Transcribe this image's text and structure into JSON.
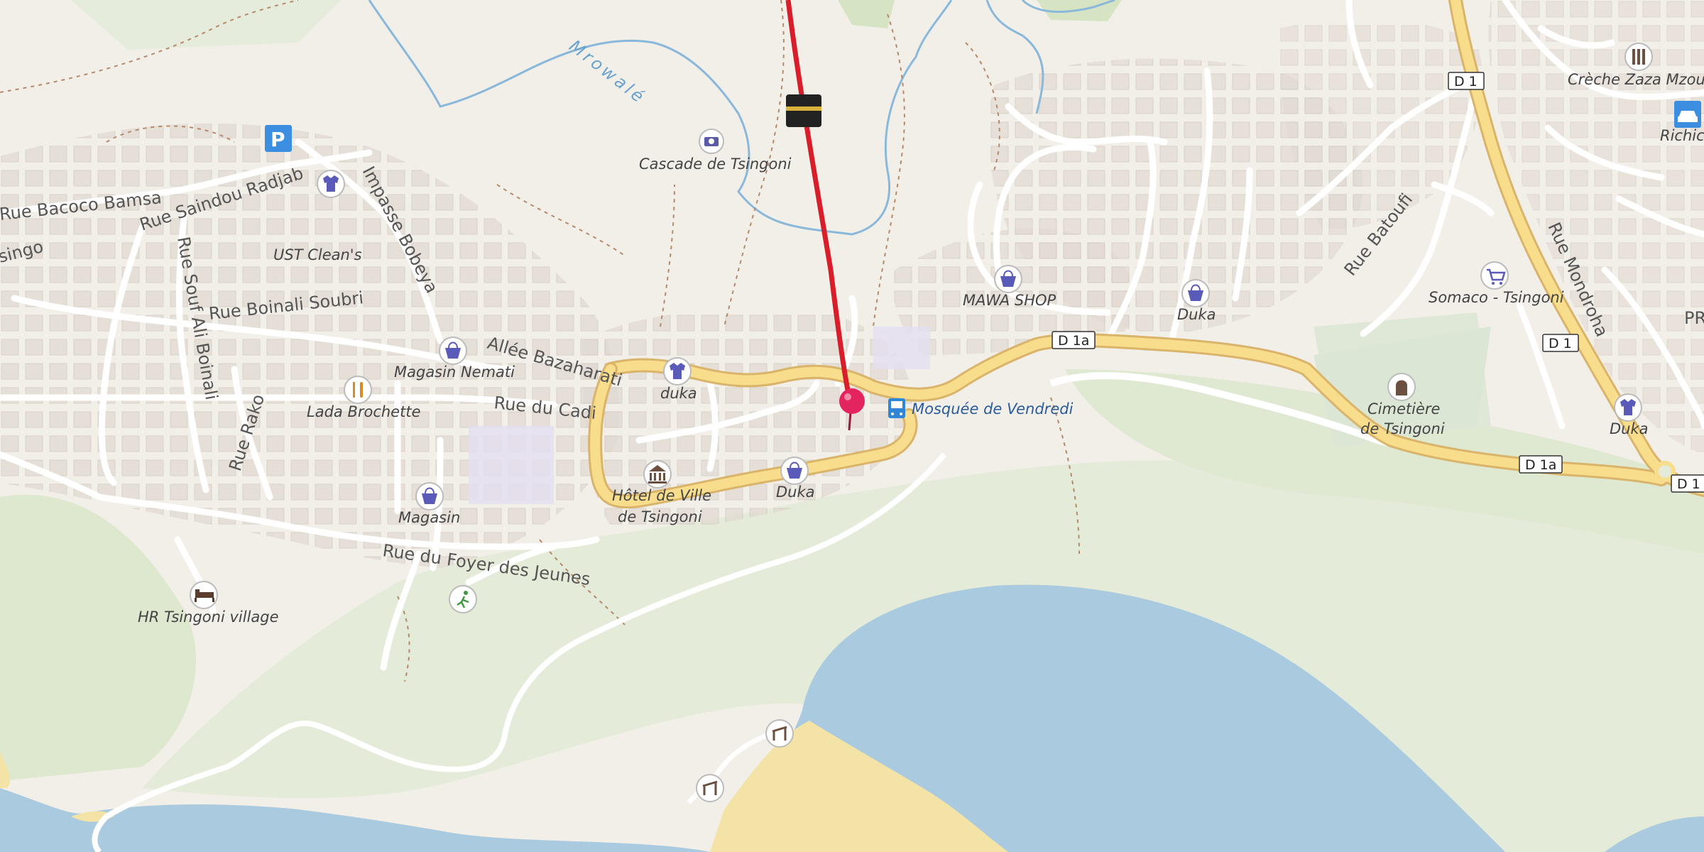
{
  "map": {
    "water_color": "#aacbdf",
    "land_color": "#f2efe9",
    "road_major_color": "#f7dd8c",
    "route_line_color": "#d81e2b",
    "pin_color": "#e4245f"
  },
  "streets": {
    "rue_bacoco_bamsa": "Rue Bacoco Bamsa",
    "singo": "singo",
    "rue_saindou_radjab": "Rue Saindou Radjab",
    "impasse_bobeya": "Impasse Bobeya",
    "rue_boinali_soubri": "Rue Boinali Soubri",
    "rue_souf_ali_boinali": "Rue Souf Ali Boinali",
    "rue_rako": "Rue Rako",
    "allee_bazaharati": "Allée Bazaharati",
    "rue_du_cadi": "Rue du Cadi",
    "rue_du_foyer_des_jeunes": "Rue du Foyer des Jeunes",
    "rue_batoufi": "Rue Batoufi",
    "rue_mondroha": "Rue Mondroha",
    "pr": "PR",
    "mrowale": "Mrowalé"
  },
  "shields": {
    "d1_top": "D 1",
    "d1_mid": "D 1",
    "d1_right": "D 1",
    "d1a_center": "D 1a",
    "d1a_right": "D 1a"
  },
  "pois": {
    "cascade": {
      "label": "Cascade de Tsingoni",
      "icon": "camera-icon"
    },
    "kaaba": {
      "icon": "kaaba-icon"
    },
    "parking": {
      "label": "P",
      "icon": "parking-icon"
    },
    "ust": {
      "label": "UST Clean's"
    },
    "shirt_saindou": {
      "icon": "shirt-icon"
    },
    "magasin_nemati": {
      "label": "Magasin Nemati",
      "icon": "basket-icon"
    },
    "lada_brochette": {
      "label": "Lada Brochette",
      "icon": "fork-knife-icon"
    },
    "magasin": {
      "label": "Magasin",
      "icon": "basket-icon"
    },
    "duka_shirt": {
      "label": "duka",
      "icon": "shirt-icon"
    },
    "hotel_de_ville_1": {
      "label": "Hôtel de Ville",
      "icon": "townhall-icon"
    },
    "hotel_de_ville_2": {
      "label": "de Tsingoni"
    },
    "duka_center": {
      "label": "Duka",
      "icon": "basket-icon"
    },
    "mosquee": {
      "label": "Mosquée de Vendredi",
      "icon": "bus-icon"
    },
    "mawa_shop": {
      "label": "MAWA SHOP",
      "icon": "basket-icon"
    },
    "duka_north": {
      "label": "Duka",
      "icon": "basket-icon"
    },
    "cimetiere_1": {
      "label": "Cimetière",
      "icon": "cemetery-icon"
    },
    "cimetiere_2": {
      "label": "de Tsingoni"
    },
    "somaco": {
      "label": "Somaco - Tsingoni",
      "icon": "cart-icon"
    },
    "creche": {
      "label": "Crèche Zaza Mzouri",
      "icon": "school-icon"
    },
    "richicc": {
      "label": "Richicc",
      "icon": "car-icon"
    },
    "duka_east": {
      "label": "Duka",
      "icon": "shirt-icon"
    },
    "hr_village": {
      "label": "HR Tsingoni village",
      "icon": "bed-icon"
    },
    "sport": {
      "icon": "sport-icon"
    },
    "shelter1": {
      "icon": "shelter-icon"
    },
    "shelter2": {
      "icon": "shelter-icon"
    },
    "pin": {
      "icon": "map-pin-icon"
    }
  }
}
